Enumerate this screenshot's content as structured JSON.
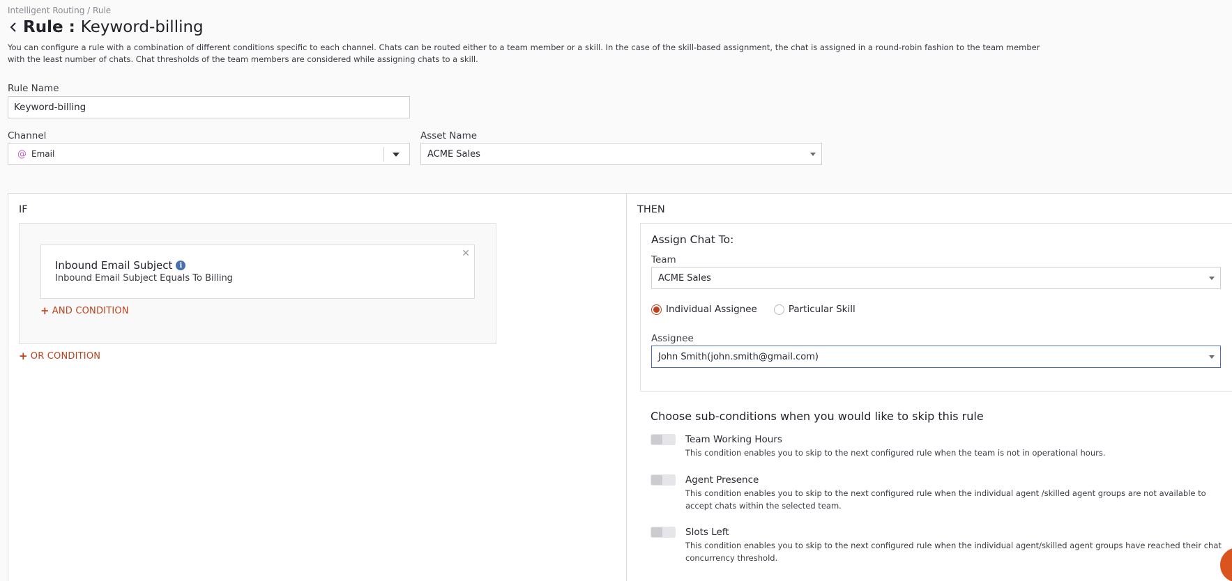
{
  "breadcrumb": "Intelligent Routing / Rule",
  "header": {
    "title_prefix": "Rule :",
    "title_name": "Keyword-billing",
    "description": "You can configure a rule with a combination of different conditions specific to each channel. Chats can be routed either to a team member or a skill. In the case of the skill-based assignment, the chat is assigned in a round-robin fashion to the team member with the least number of chats. Chat thresholds of the team members are considered while assigning chats to a skill."
  },
  "form": {
    "rule_name_label": "Rule Name",
    "rule_name_value": "Keyword-billing",
    "channel_label": "Channel",
    "channel_value": "Email",
    "channel_icon": "@",
    "asset_label": "Asset Name",
    "asset_value": "ACME Sales"
  },
  "if_section": {
    "title": "IF",
    "condition": {
      "title": "Inbound Email Subject",
      "description": "Inbound Email Subject Equals To Billing"
    },
    "and_label": "AND CONDITION",
    "or_label": "OR CONDITION"
  },
  "then_section": {
    "title": "THEN",
    "assign_title": "Assign Chat To:",
    "team_label": "Team",
    "team_value": "ACME Sales",
    "radio_individual": "Individual Assignee",
    "radio_skill": "Particular Skill",
    "assignee_label": "Assignee",
    "assignee_value": "John Smith(john.smith@gmail.com)"
  },
  "sub_conditions": {
    "title": "Choose sub-conditions when you would like to skip this rule",
    "items": [
      {
        "label": "Team Working Hours",
        "description": "This condition enables you to skip to the next configured rule when the team is not in operational hours."
      },
      {
        "label": "Agent Presence",
        "description": "This condition enables you to skip to the next configured rule when the individual agent /skilled agent groups are not available to accept chats within the selected team."
      },
      {
        "label": "Slots Left",
        "description": "This condition enables you to skip to the next configured rule when the individual agent/skilled agent groups have reached their chat concurrency threshold."
      }
    ]
  },
  "colors": {
    "accent": "#c0421c",
    "focus_border": "#4a6fb0",
    "fab": "#d9541e"
  }
}
